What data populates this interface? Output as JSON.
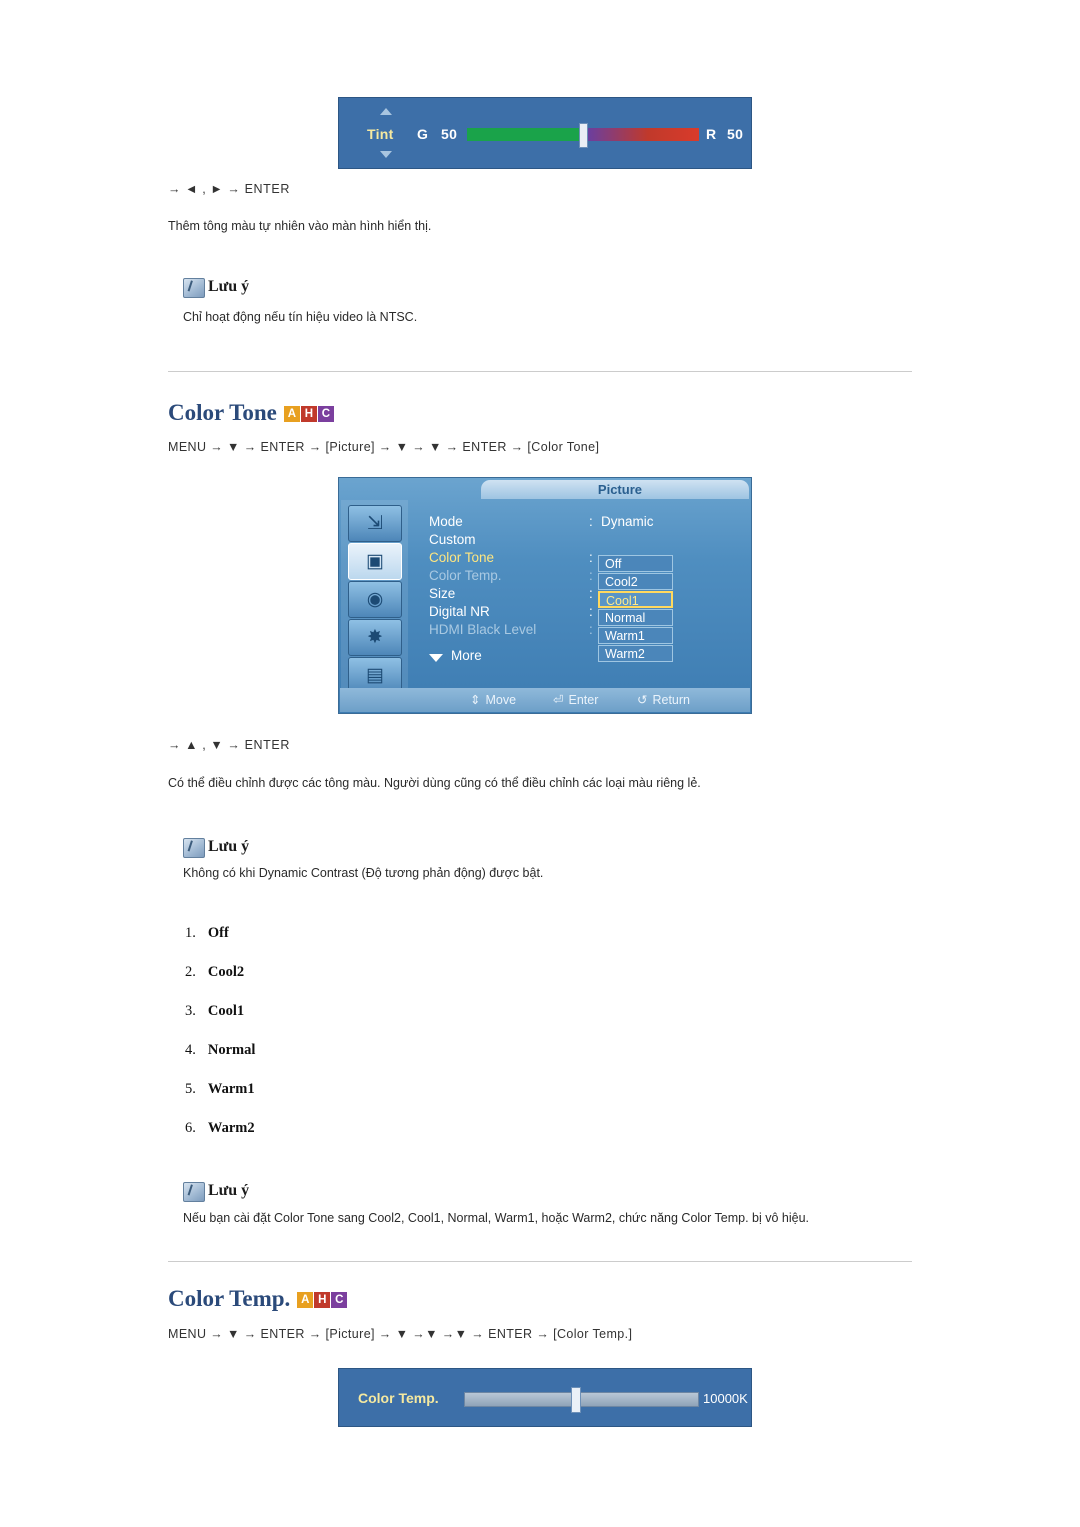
{
  "osd_tint": {
    "label": "Tint",
    "left_label": "G",
    "left_value": "50",
    "right_label": "R",
    "right_value": "50"
  },
  "tint_section": {
    "nav": "→ ◄ , ► → ENTER",
    "description": "Thêm tông màu tự nhiên vào màn hình hiển thị.",
    "note_title": "Lưu ý",
    "note_body": "Chỉ hoạt động nếu tín hiệu video là NTSC."
  },
  "color_tone": {
    "heading": "Color Tone",
    "badges": [
      "A",
      "H",
      "C"
    ],
    "menupath": "MENU → ▼ → ENTER → [Picture] → ▼ → ▼ → ENTER → [Color Tone]",
    "nav": "→ ▲ , ▼ → ENTER",
    "description": "Có thể điều chỉnh được các tông màu. Người dùng cũng có thể điều chỉnh các loại màu riêng lẻ.",
    "note_title": "Lưu ý",
    "note_body": "Không có khi Dynamic Contrast (Độ tương phản động) được bật.",
    "options": [
      {
        "num": "1.",
        "label": "Off"
      },
      {
        "num": "2.",
        "label": "Cool2"
      },
      {
        "num": "3.",
        "label": "Cool1"
      },
      {
        "num": "4.",
        "label": "Normal"
      },
      {
        "num": "5.",
        "label": "Warm1"
      },
      {
        "num": "6.",
        "label": "Warm2"
      }
    ],
    "note2_title": "Lưu ý",
    "note2_body": "Nếu bạn cài đặt Color Tone sang Cool2, Cool1, Normal, Warm1, hoặc Warm2, chức năng Color Temp. bị vô hiệu."
  },
  "osd_picture": {
    "title": "Picture",
    "rows": [
      {
        "name": "Mode",
        "colon": ":",
        "value": "Dynamic",
        "state": "normal"
      },
      {
        "name": "Custom",
        "colon": "",
        "value": "",
        "state": "normal"
      },
      {
        "name": "Color Tone",
        "colon": ":",
        "value": "",
        "state": "highlight"
      },
      {
        "name": "Color Temp.",
        "colon": ":",
        "value": "",
        "state": "dim"
      },
      {
        "name": "Size",
        "colon": ":",
        "value": "",
        "state": "normal"
      },
      {
        "name": "Digital NR",
        "colon": ":",
        "value": "",
        "state": "normal"
      },
      {
        "name": "HDMI Black Level",
        "colon": ":",
        "value": "",
        "state": "dim"
      }
    ],
    "more_label": "More",
    "dropdown": {
      "items": [
        "Off",
        "Cool2",
        "Cool1",
        "Normal",
        "Warm1",
        "Warm2"
      ],
      "selected": "Cool1"
    },
    "icons": [
      "input-icon",
      "picture-icon",
      "sound-icon",
      "setup-icon",
      "multi-control-icon"
    ],
    "footer": [
      {
        "glyph": "⇕",
        "label": "Move",
        "name": "move"
      },
      {
        "glyph": "⏎",
        "label": "Enter",
        "name": "enter"
      },
      {
        "glyph": "↺",
        "label": "Return",
        "name": "return"
      }
    ]
  },
  "color_temp": {
    "heading": "Color Temp.",
    "badges": [
      "A",
      "H",
      "C"
    ],
    "menupath": "MENU → ▼ → ENTER → [Picture] → ▼ →▼ →▼ → ENTER → [Color Temp.]",
    "osd_label": "Color Temp.",
    "osd_value": "10000K"
  }
}
